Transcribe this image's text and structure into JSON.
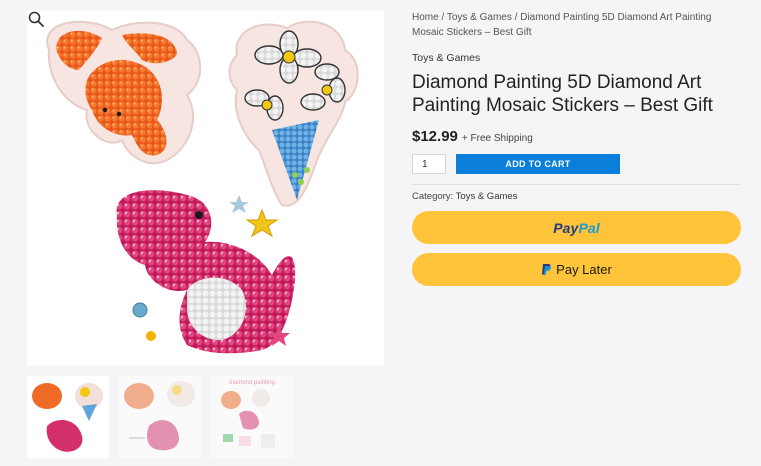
{
  "breadcrumb": {
    "home": "Home",
    "sep1": " / ",
    "category": "Toys & Games",
    "sep2": " / ",
    "current": "Diamond Painting 5D Diamond Art Painting Mosaic Stickers – Best Gift"
  },
  "product": {
    "category_label": "Toys & Games",
    "title": "Diamond Painting 5D Diamond Art Painting Mosaic Stickers – Best Gift",
    "price": "$12.99",
    "shipping": "+ Free Shipping",
    "quantity": "1",
    "add_to_cart": "ADD TO CART",
    "meta_label": "Category:",
    "meta_value": "Toys & Games"
  },
  "paypal": {
    "logo_pay": "Pay",
    "logo_pal": "Pal",
    "pay_later": "Pay Later",
    "brand_yellow": "#ffc439",
    "brand_dark_blue": "#253b80",
    "brand_light_blue": "#179bd7"
  },
  "gallery": {
    "zoom_icon": "magnifier-icon",
    "thumb3_caption": "diamond painting"
  },
  "colors": {
    "accent": "#0a7fd9"
  }
}
